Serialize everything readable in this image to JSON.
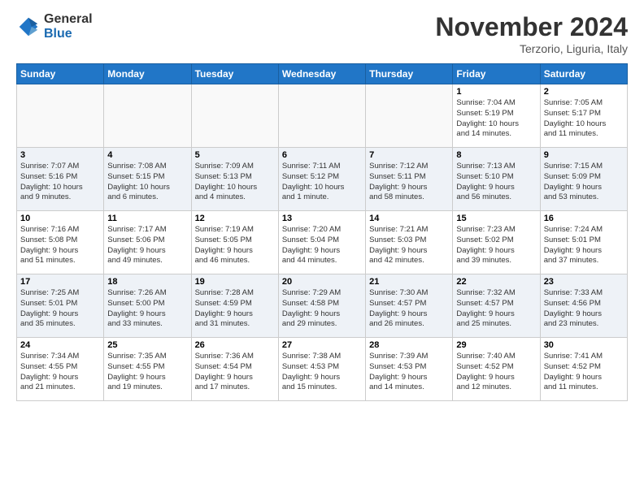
{
  "header": {
    "logo_general": "General",
    "logo_blue": "Blue",
    "month_title": "November 2024",
    "location": "Terzorio, Liguria, Italy"
  },
  "days_of_week": [
    "Sunday",
    "Monday",
    "Tuesday",
    "Wednesday",
    "Thursday",
    "Friday",
    "Saturday"
  ],
  "weeks": [
    {
      "row_class": "row1",
      "days": [
        {
          "num": "",
          "info": "",
          "empty": true
        },
        {
          "num": "",
          "info": "",
          "empty": true
        },
        {
          "num": "",
          "info": "",
          "empty": true
        },
        {
          "num": "",
          "info": "",
          "empty": true
        },
        {
          "num": "",
          "info": "",
          "empty": true
        },
        {
          "num": "1",
          "info": "Sunrise: 7:04 AM\nSunset: 5:19 PM\nDaylight: 10 hours\nand 14 minutes."
        },
        {
          "num": "2",
          "info": "Sunrise: 7:05 AM\nSunset: 5:17 PM\nDaylight: 10 hours\nand 11 minutes."
        }
      ]
    },
    {
      "row_class": "row2",
      "days": [
        {
          "num": "3",
          "info": "Sunrise: 7:07 AM\nSunset: 5:16 PM\nDaylight: 10 hours\nand 9 minutes."
        },
        {
          "num": "4",
          "info": "Sunrise: 7:08 AM\nSunset: 5:15 PM\nDaylight: 10 hours\nand 6 minutes."
        },
        {
          "num": "5",
          "info": "Sunrise: 7:09 AM\nSunset: 5:13 PM\nDaylight: 10 hours\nand 4 minutes."
        },
        {
          "num": "6",
          "info": "Sunrise: 7:11 AM\nSunset: 5:12 PM\nDaylight: 10 hours\nand 1 minute."
        },
        {
          "num": "7",
          "info": "Sunrise: 7:12 AM\nSunset: 5:11 PM\nDaylight: 9 hours\nand 58 minutes."
        },
        {
          "num": "8",
          "info": "Sunrise: 7:13 AM\nSunset: 5:10 PM\nDaylight: 9 hours\nand 56 minutes."
        },
        {
          "num": "9",
          "info": "Sunrise: 7:15 AM\nSunset: 5:09 PM\nDaylight: 9 hours\nand 53 minutes."
        }
      ]
    },
    {
      "row_class": "row3",
      "days": [
        {
          "num": "10",
          "info": "Sunrise: 7:16 AM\nSunset: 5:08 PM\nDaylight: 9 hours\nand 51 minutes."
        },
        {
          "num": "11",
          "info": "Sunrise: 7:17 AM\nSunset: 5:06 PM\nDaylight: 9 hours\nand 49 minutes."
        },
        {
          "num": "12",
          "info": "Sunrise: 7:19 AM\nSunset: 5:05 PM\nDaylight: 9 hours\nand 46 minutes."
        },
        {
          "num": "13",
          "info": "Sunrise: 7:20 AM\nSunset: 5:04 PM\nDaylight: 9 hours\nand 44 minutes."
        },
        {
          "num": "14",
          "info": "Sunrise: 7:21 AM\nSunset: 5:03 PM\nDaylight: 9 hours\nand 42 minutes."
        },
        {
          "num": "15",
          "info": "Sunrise: 7:23 AM\nSunset: 5:02 PM\nDaylight: 9 hours\nand 39 minutes."
        },
        {
          "num": "16",
          "info": "Sunrise: 7:24 AM\nSunset: 5:01 PM\nDaylight: 9 hours\nand 37 minutes."
        }
      ]
    },
    {
      "row_class": "row4",
      "days": [
        {
          "num": "17",
          "info": "Sunrise: 7:25 AM\nSunset: 5:01 PM\nDaylight: 9 hours\nand 35 minutes."
        },
        {
          "num": "18",
          "info": "Sunrise: 7:26 AM\nSunset: 5:00 PM\nDaylight: 9 hours\nand 33 minutes."
        },
        {
          "num": "19",
          "info": "Sunrise: 7:28 AM\nSunset: 4:59 PM\nDaylight: 9 hours\nand 31 minutes."
        },
        {
          "num": "20",
          "info": "Sunrise: 7:29 AM\nSunset: 4:58 PM\nDaylight: 9 hours\nand 29 minutes."
        },
        {
          "num": "21",
          "info": "Sunrise: 7:30 AM\nSunset: 4:57 PM\nDaylight: 9 hours\nand 26 minutes."
        },
        {
          "num": "22",
          "info": "Sunrise: 7:32 AM\nSunset: 4:57 PM\nDaylight: 9 hours\nand 25 minutes."
        },
        {
          "num": "23",
          "info": "Sunrise: 7:33 AM\nSunset: 4:56 PM\nDaylight: 9 hours\nand 23 minutes."
        }
      ]
    },
    {
      "row_class": "row5",
      "days": [
        {
          "num": "24",
          "info": "Sunrise: 7:34 AM\nSunset: 4:55 PM\nDaylight: 9 hours\nand 21 minutes."
        },
        {
          "num": "25",
          "info": "Sunrise: 7:35 AM\nSunset: 4:55 PM\nDaylight: 9 hours\nand 19 minutes."
        },
        {
          "num": "26",
          "info": "Sunrise: 7:36 AM\nSunset: 4:54 PM\nDaylight: 9 hours\nand 17 minutes."
        },
        {
          "num": "27",
          "info": "Sunrise: 7:38 AM\nSunset: 4:53 PM\nDaylight: 9 hours\nand 15 minutes."
        },
        {
          "num": "28",
          "info": "Sunrise: 7:39 AM\nSunset: 4:53 PM\nDaylight: 9 hours\nand 14 minutes."
        },
        {
          "num": "29",
          "info": "Sunrise: 7:40 AM\nSunset: 4:52 PM\nDaylight: 9 hours\nand 12 minutes."
        },
        {
          "num": "30",
          "info": "Sunrise: 7:41 AM\nSunset: 4:52 PM\nDaylight: 9 hours\nand 11 minutes."
        }
      ]
    }
  ]
}
